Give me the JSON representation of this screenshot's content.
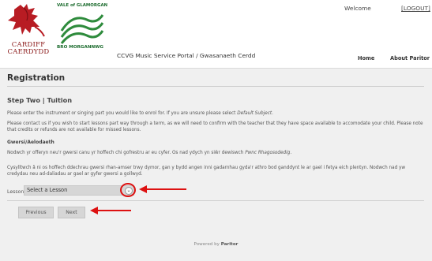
{
  "header": {
    "cardiff_logo_text_line1": "CARDIFF",
    "cardiff_logo_text_line2": "CAERDYDD",
    "vale_logo_top": "VALE of GLAMORGAN",
    "vale_logo_bottom": "BRO MORGANNWG",
    "portal_title": "CCVG Music Service Portal / Gwasanaeth Cerdd",
    "welcome": "Welcome",
    "logout": "[LOGOUT]",
    "nav": {
      "home": "Home",
      "about": "About Paritor"
    }
  },
  "main": {
    "title": "Registration",
    "step_title": "Step Two | Tuition",
    "instruction_prefix": "Please enter the instrument or singing part you would like to enrol for. If you are unsure please select ",
    "instruction_em": "Default Subject",
    "instruction_suffix": ".",
    "contact_text": "Please contact us if you wish to start lessons part way through a term, as we will need to confirm with the teacher that they have space available to accomodate your child. Please note that credits or refunds are not available for missed lessons.",
    "welsh_heading": "Gwersi/Aelodaeth",
    "welsh_p1_prefix": "Nodwch yr offeryn neu'r gwersi canu yr hoffech chi gofrestru ar eu cyfer. Os nad ydych yn siŵr dewiswch ",
    "welsh_p1_em": "Pwnc Rhagosodedig",
    "welsh_p1_suffix": ".",
    "welsh_p2": "Cysylltwch â ni os hoffech ddechrau gwersi rhan-amser trwy dymor, gan y bydd angen inni gadarnhau gyda'r athro bod ganddynt le ar gael i fetya eich plentyn. Nodwch nad yw credydau neu ad-daliadau ar gael ar gyfer gwersi a gollwyd.",
    "lesson_label": "Lesson",
    "lesson_select_value": "Select a Lesson",
    "buttons": {
      "previous": "Previous",
      "next": "Next"
    },
    "powered_prefix": "Powered by ",
    "powered_brand": "Paritor"
  },
  "colors": {
    "annotation_red": "#dd1111",
    "panel_bg": "#f0f0f0"
  },
  "icons": {
    "select_arrow": "chevron-down-icon"
  }
}
